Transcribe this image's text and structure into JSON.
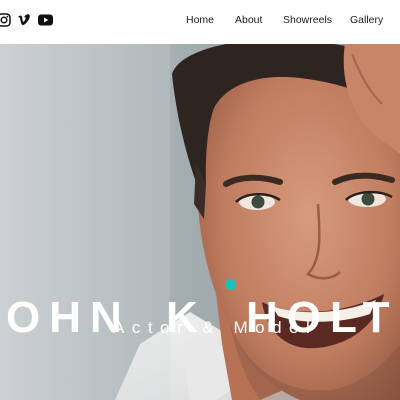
{
  "header": {
    "social": [
      {
        "icon": "instagram-icon"
      },
      {
        "icon": "vimeo-icon"
      },
      {
        "icon": "youtube-icon"
      }
    ],
    "nav": [
      {
        "label": "Home"
      },
      {
        "label": "About"
      },
      {
        "label": "Showreels"
      },
      {
        "label": "Gallery"
      }
    ]
  },
  "hero": {
    "name_parts": [
      "OHN",
      "K",
      "HOLT"
    ],
    "tagline": "Actor & Model",
    "accent_color": "#19c3ba",
    "photo_subject": "portrait of smiling man in white shirt"
  }
}
